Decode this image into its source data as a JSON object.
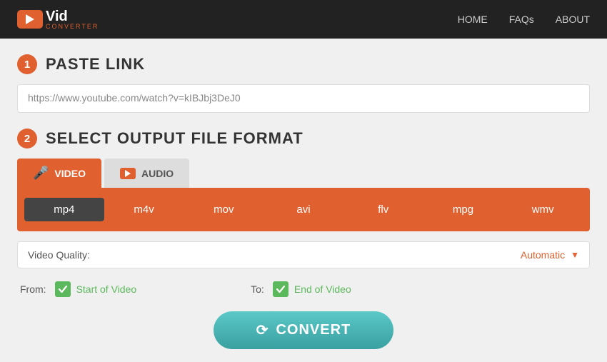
{
  "header": {
    "logo_vid": "Vid",
    "logo_converter": "CONVERTER",
    "nav": {
      "home": "HOME",
      "faqs": "FAQs",
      "about": "ABOUT"
    }
  },
  "step1": {
    "number": "1",
    "title": "PASTE LINK",
    "url_placeholder": "https://www.youtube.com/watch?v=kIBJbj3DeJ0",
    "url_value": "https://www.youtube.com/watch?v=kIBJbj3DeJ0"
  },
  "step2": {
    "number": "2",
    "title": "SELECT OUTPUT FILE FORMAT",
    "tabs": [
      {
        "id": "video",
        "label": "VIDEO",
        "active": true
      },
      {
        "id": "audio",
        "label": "AUDIO",
        "active": false
      }
    ],
    "formats": [
      {
        "id": "mp4",
        "label": "mp4",
        "selected": true
      },
      {
        "id": "m4v",
        "label": "m4v",
        "selected": false
      },
      {
        "id": "mov",
        "label": "mov",
        "selected": false
      },
      {
        "id": "avi",
        "label": "avi",
        "selected": false
      },
      {
        "id": "flv",
        "label": "flv",
        "selected": false
      },
      {
        "id": "mpg",
        "label": "mpg",
        "selected": false
      },
      {
        "id": "wmv",
        "label": "wmv",
        "selected": false
      }
    ],
    "quality_label": "Video Quality:",
    "quality_value": "Automatic"
  },
  "from_to": {
    "from_label": "From:",
    "from_value": "Start of Video",
    "to_label": "To:",
    "to_value": "End of Video"
  },
  "convert_button": {
    "label": "CONVERT"
  }
}
